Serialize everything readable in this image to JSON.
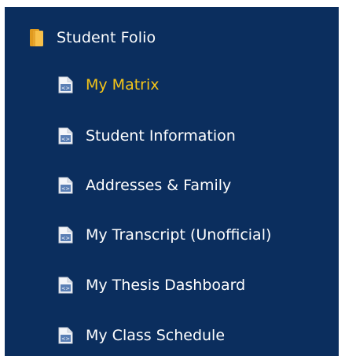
{
  "menu": {
    "folder": {
      "label": "Student Folio",
      "icon": "folder-icon"
    },
    "items": [
      {
        "label": "My Matrix",
        "icon": "document-icon",
        "active": true
      },
      {
        "label": "Student Information",
        "icon": "document-icon",
        "active": false
      },
      {
        "label": "Addresses & Family",
        "icon": "document-icon",
        "active": false
      },
      {
        "label": "My Transcript (Unofficial)",
        "icon": "document-icon",
        "active": false
      },
      {
        "label": "My Thesis Dashboard",
        "icon": "document-icon",
        "active": false
      },
      {
        "label": "My Class Schedule",
        "icon": "document-icon",
        "active": false
      }
    ]
  },
  "colors": {
    "background": "#0b2e5e",
    "text": "#ffffff",
    "active_text": "#f5c518",
    "folder_icon": "#f2b33d"
  }
}
